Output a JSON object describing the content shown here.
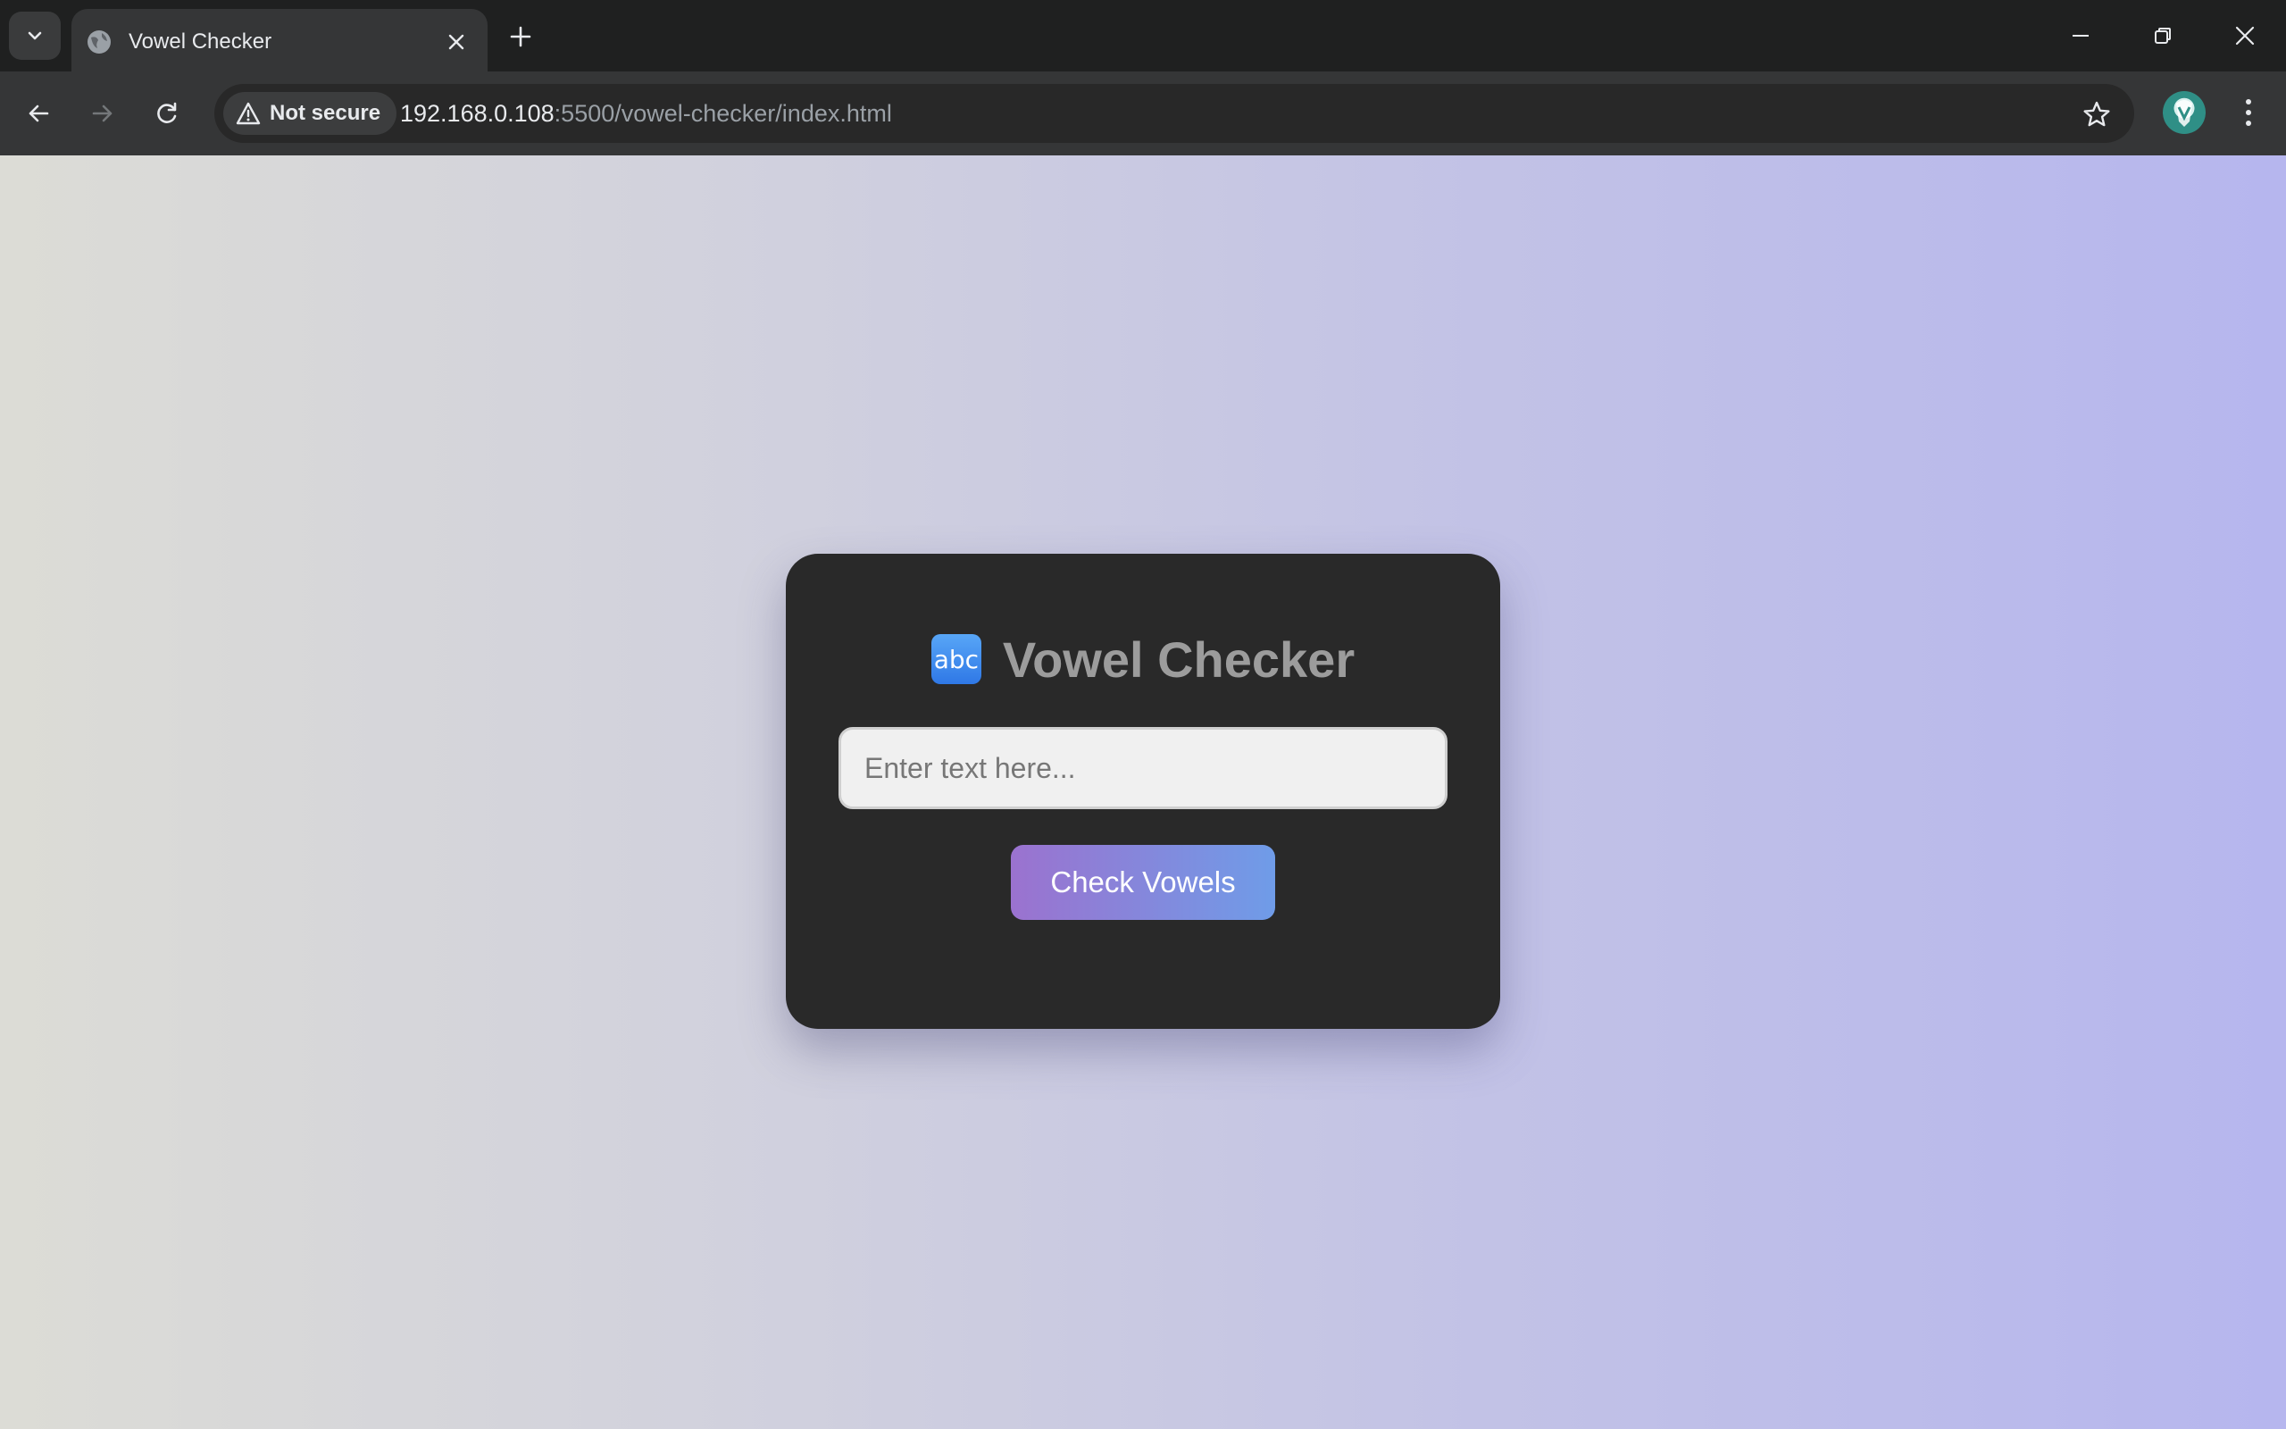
{
  "browser": {
    "tab_title": "Vowel Checker",
    "security_label": "Not secure",
    "url_host": "192.168.0.108",
    "url_rest": ":5500/vowel-checker/index.html"
  },
  "page": {
    "icon_text": "abc",
    "heading": "Vowel Checker",
    "input_placeholder": "Enter text here...",
    "input_value": "",
    "button_label": "Check Vowels"
  },
  "colors": {
    "card_background": "#292929",
    "button_gradient_start": "#9b72cf",
    "button_gradient_end": "#6f9ce8",
    "heading_text": "#9c9c9c"
  }
}
